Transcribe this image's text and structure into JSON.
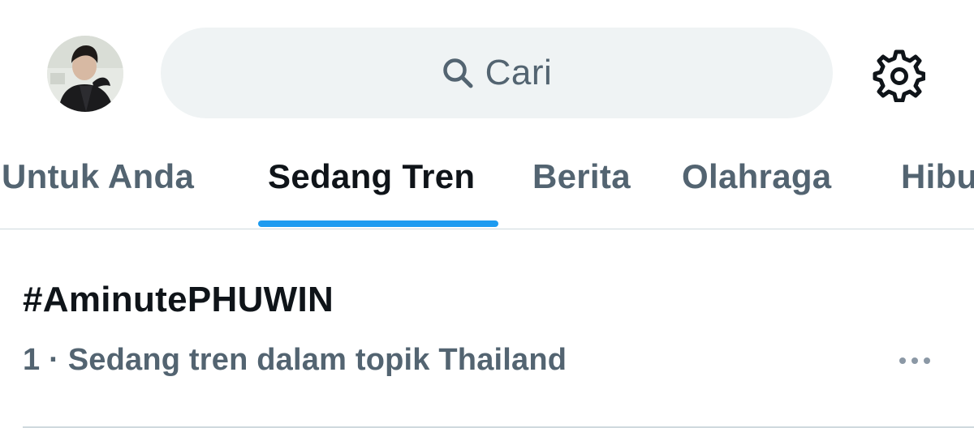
{
  "header": {
    "avatar_icon": "profile-avatar-photo",
    "search": {
      "icon": "search-icon",
      "placeholder": "Cari"
    },
    "settings_icon": "gear-icon"
  },
  "tabs": [
    {
      "label": "Untuk Anda",
      "active": false
    },
    {
      "label": "Sedang Tren",
      "active": true
    },
    {
      "label": "Berita",
      "active": false
    },
    {
      "label": "Olahraga",
      "active": false
    },
    {
      "label": "Hibu",
      "active": false
    }
  ],
  "trends": [
    {
      "title": "#AminutePHUWIN",
      "meta": "1 · Sedang tren dalam topik Thailand",
      "more_icon": "more-horizontal-icon"
    }
  ],
  "colors": {
    "accent": "#1d9bf0",
    "text_primary": "#0f1419",
    "text_secondary": "#536471",
    "search_bg": "#eff3f4",
    "divider": "#cfd9de"
  }
}
